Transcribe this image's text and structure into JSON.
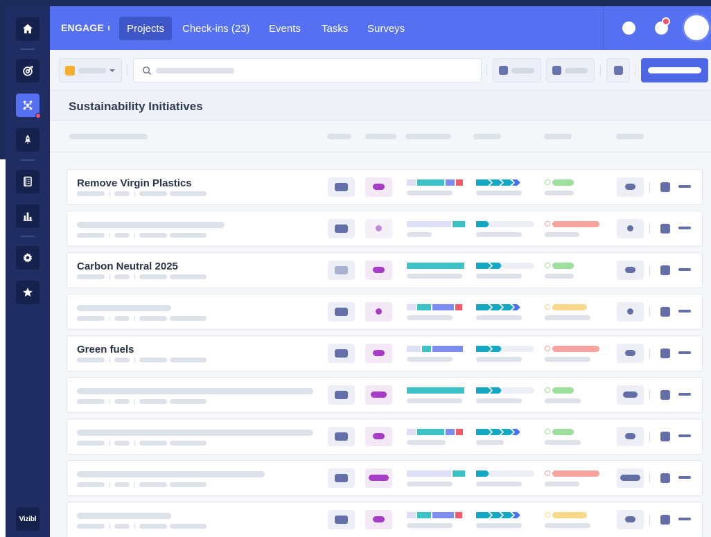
{
  "app": {
    "name": "ENGAGE",
    "brand": "Vizibl"
  },
  "header": {
    "tabs": [
      {
        "label": "Projects",
        "active": true
      },
      {
        "label": "Check-ins (23)",
        "active": false
      },
      {
        "label": "Events",
        "active": false
      },
      {
        "label": "Tasks",
        "active": false
      },
      {
        "label": "Surveys",
        "active": false
      }
    ]
  },
  "sidebar": {
    "items": [
      {
        "icon": "home-icon"
      },
      {
        "icon": "target-icon"
      },
      {
        "icon": "hierarchy-icon",
        "active": true
      },
      {
        "icon": "rocket-icon"
      },
      {
        "icon": "book-icon"
      },
      {
        "icon": "bar-chart-icon"
      },
      {
        "icon": "gear-icon"
      },
      {
        "icon": "star-icon"
      }
    ]
  },
  "section": {
    "title": "Sustainability Initiatives"
  },
  "colors": {
    "accent": "#5571f2",
    "sidebar": "#1f2d62",
    "teal": "#3cc3c7",
    "purple": "#a53dc6",
    "green": "#9de09b",
    "red": "#f7a39e",
    "yellow": "#f9d88a"
  },
  "rows": [
    {
      "title": "Remove Virgin Plastics"
    },
    {
      "title": ""
    },
    {
      "title": "Carbon Neutral 2025"
    },
    {
      "title": ""
    },
    {
      "title": "Green fuels"
    },
    {
      "title": ""
    },
    {
      "title": ""
    },
    {
      "title": ""
    },
    {
      "title": ""
    }
  ]
}
